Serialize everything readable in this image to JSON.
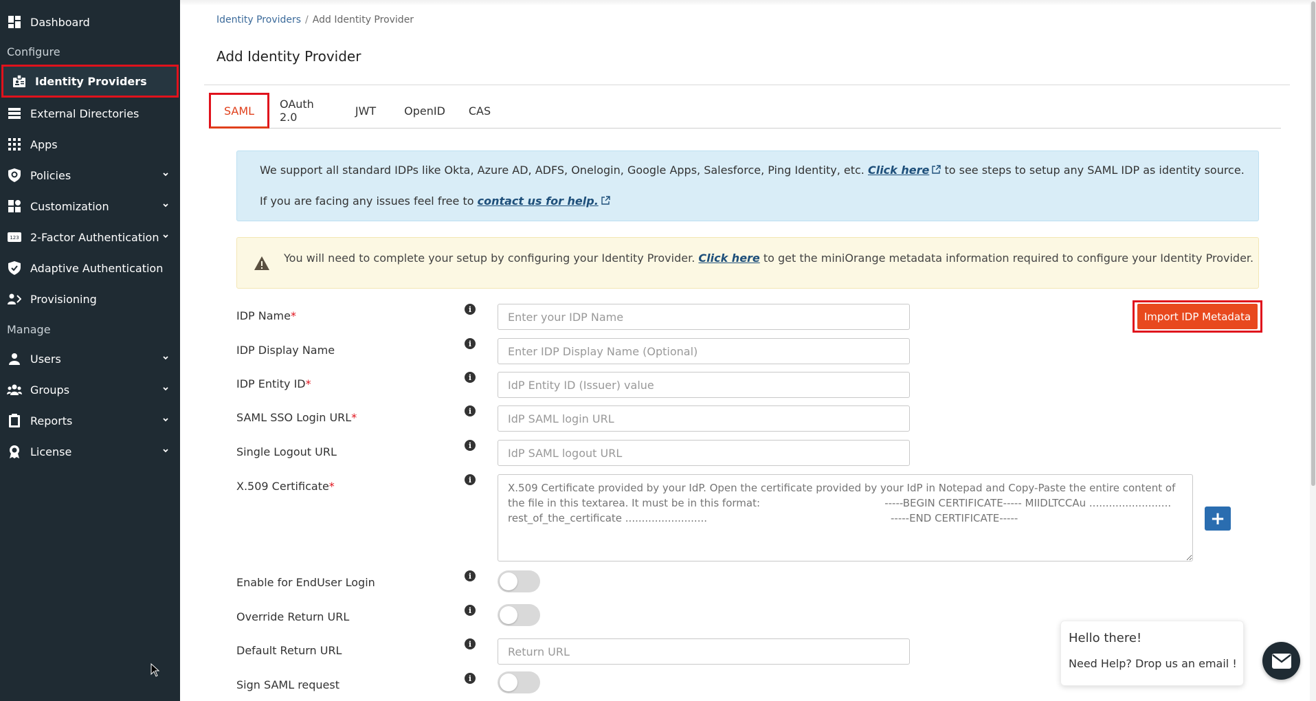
{
  "sidebar": {
    "sections": {
      "configure": "Configure",
      "manage": "Manage"
    },
    "items": [
      {
        "label": "Dashboard",
        "icon": "dashboard-icon"
      },
      {
        "label": "Identity Providers",
        "icon": "id-badge-icon",
        "active": true
      },
      {
        "label": "External Directories",
        "icon": "directory-list-icon"
      },
      {
        "label": "Apps",
        "icon": "apps-grid-icon"
      },
      {
        "label": "Policies",
        "icon": "shield-policy-icon",
        "expandable": true
      },
      {
        "label": "Customization",
        "icon": "customization-icon",
        "expandable": true
      },
      {
        "label": "2-Factor Authentication",
        "icon": "2fa-123-icon",
        "expandable": true
      },
      {
        "label": "Adaptive Authentication",
        "icon": "shield-check-icon"
      },
      {
        "label": "Provisioning",
        "icon": "provisioning-icon"
      },
      {
        "label": "Users",
        "icon": "user-icon",
        "expandable": true
      },
      {
        "label": "Groups",
        "icon": "groups-icon",
        "expandable": true
      },
      {
        "label": "Reports",
        "icon": "clipboard-icon",
        "expandable": true
      },
      {
        "label": "License",
        "icon": "license-icon",
        "expandable": true
      }
    ]
  },
  "breadcrumb": {
    "parent": "Identity Providers",
    "current": "Add Identity Provider"
  },
  "page_title": "Add Identity Provider",
  "tabs": [
    {
      "label": "SAML",
      "active": true
    },
    {
      "label": "OAuth 2.0"
    },
    {
      "label": "JWT"
    },
    {
      "label": "OpenID"
    },
    {
      "label": "CAS"
    }
  ],
  "info_box": {
    "line1_pre": "We support all standard IDPs like Okta, Azure AD, ADFS, Onelogin, Google Apps, Salesforce, Ping Identity, etc.",
    "line1_link": "Click here",
    "line1_post": "to see steps to setup any SAML IDP as identity source.",
    "line2_pre": "If you are facing any issues feel free to",
    "line2_link": "contact us for help."
  },
  "warning_box": {
    "pre": "You will need to complete your setup by configuring your Identity Provider.",
    "link": "Click here",
    "post": "to get the miniOrange metadata information required to configure your Identity Provider."
  },
  "form": {
    "idp_name": {
      "label": "IDP Name",
      "placeholder": "Enter your IDP Name"
    },
    "idp_display_name": {
      "label": "IDP Display Name",
      "placeholder": "Enter IDP Display Name (Optional)"
    },
    "idp_entity_id": {
      "label": "IDP Entity ID",
      "placeholder": "IdP Entity ID (Issuer) value"
    },
    "saml_sso_login_url": {
      "label": "SAML SSO Login URL",
      "placeholder": "IdP SAML login URL"
    },
    "single_logout_url": {
      "label": "Single Logout URL",
      "placeholder": "IdP SAML logout URL"
    },
    "x509_certificate": {
      "label": "X.509 Certificate",
      "placeholder": "X.509 Certificate provided by your IdP. Open the certificate provided by your IdP in Notepad and Copy-Paste the entire content of the file in this textarea. It must be in this format:                                      -----BEGIN CERTIFICATE----- MIIDLTCCAu ......................... rest_of_the_certificate .........................                                                        -----END CERTIFICATE-----"
    },
    "enable_enduser_login": {
      "label": "Enable for EndUser Login",
      "on": false
    },
    "override_return_url": {
      "label": "Override Return URL",
      "on": false
    },
    "default_return_url": {
      "label": "Default Return URL",
      "placeholder": "Return URL"
    },
    "sign_saml_request": {
      "label": "Sign SAML request",
      "on": false
    },
    "required_marker": "*",
    "info_glyph": "i",
    "add_glyph": "+"
  },
  "import_button": "Import IDP Metadata",
  "chat": {
    "greeting": "Hello there!",
    "message": "Need Help? Drop us an email !"
  },
  "colors": {
    "sidebar": "#1f2b33",
    "accent": "#e8491e",
    "highlight": "#e0121c",
    "info_bg": "#d9edf7",
    "warn_bg": "#fcf8e3",
    "primary_button": "#2a6db0"
  }
}
